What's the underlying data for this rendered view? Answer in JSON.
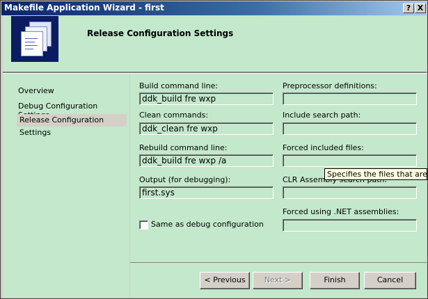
{
  "window": {
    "title": "Makefile Application Wizard - first",
    "help_glyph": "?",
    "close_glyph": "X"
  },
  "header": {
    "heading": "Release Configuration Settings"
  },
  "nav": {
    "items": [
      {
        "label": "Overview"
      },
      {
        "label": "Debug Configuration Settings"
      },
      {
        "label": "Release Configuration Settings"
      }
    ]
  },
  "form": {
    "build_label": "Build command line:",
    "build_value": "ddk_build fre wxp",
    "clean_label": "Clean commands:",
    "clean_value": "ddk_clean fre wxp",
    "rebuild_label": "Rebuild command line:",
    "rebuild_value": "ddk_build fre wxp /a",
    "output_label": "Output (for debugging):",
    "output_value": "first.sys",
    "same_as_debug_label": "Same as debug configuration",
    "preproc_label": "Preprocessor definitions:",
    "preproc_value": "",
    "include_label": "Include search path:",
    "include_value": "",
    "forced_label": "Forced included files:",
    "forced_value": "",
    "clr_label": "CLR Assembly search path:",
    "clr_value": "",
    "net_label": "Forced using .NET assemblies:",
    "net_value": ""
  },
  "tooltip": {
    "text": "Specifies the files that are forc"
  },
  "buttons": {
    "previous": "< Previous",
    "next": "Next >",
    "finish": "Finish",
    "cancel": "Cancel"
  },
  "colors": {
    "panel_green": "#c3e8cb",
    "titlebar_start": "#0a246a",
    "dialog_gray": "#d4d0c8"
  }
}
